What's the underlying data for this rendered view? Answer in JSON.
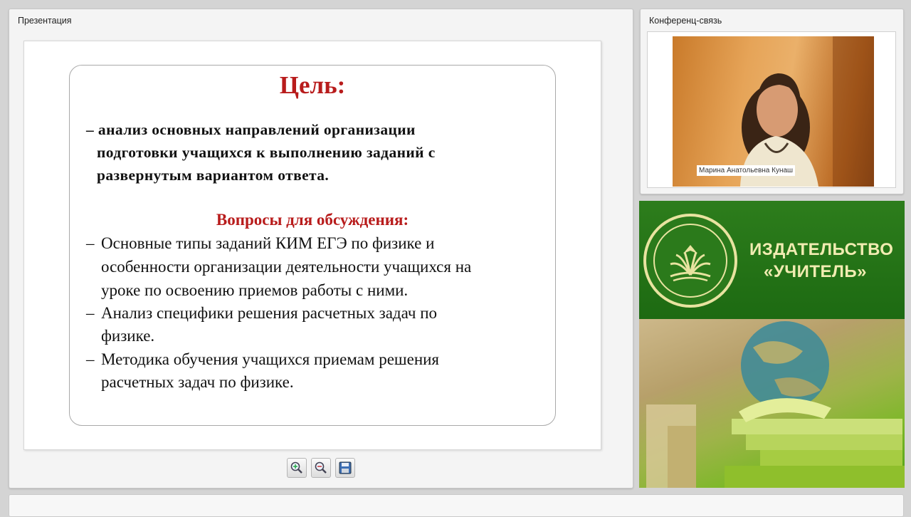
{
  "presentation": {
    "panel_title": "Презентация",
    "slide": {
      "title": "Цель:",
      "goal_lines": [
        "– анализ основных направлений организации",
        "подготовки учащихся к выполнению заданий с",
        "развернутым вариантом ответа."
      ],
      "questions_title": "Вопросы для обсуждения:",
      "questions": [
        {
          "lines": [
            "Основные типы заданий КИМ ЕГЭ по физике и",
            "особенности организации деятельности учащихся на",
            "уроке по освоению приемов работы с ними."
          ]
        },
        {
          "lines": [
            "Анализ специфики решения расчетных задач по",
            "физике."
          ]
        },
        {
          "lines": [
            "Методика обучения учащихся приемам решения",
            "расчетных задач по физике."
          ]
        }
      ],
      "bullet": "–"
    },
    "toolbar": {
      "zoom_in": "zoom-in-icon",
      "zoom_out": "zoom-out-icon",
      "save": "floppy-disk-icon"
    }
  },
  "conference": {
    "panel_title": "Конференц-связь",
    "speaker_name": "Марина Анатольевна Кунаш"
  },
  "banner": {
    "line1": "ИЗДАТЕЛЬСТВО",
    "line2": "«УЧИТЕЛЬ»",
    "colors": {
      "green": "#2d7d1c",
      "cream": "#f1ecb1"
    }
  },
  "colors": {
    "accent_red": "#b81c1c"
  }
}
